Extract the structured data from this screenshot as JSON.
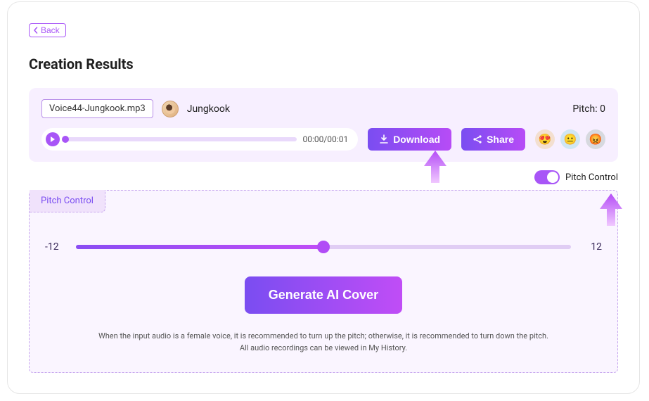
{
  "nav": {
    "back_label": "Back"
  },
  "page": {
    "title": "Creation Results"
  },
  "result": {
    "filename": "Voice44-Jungkook.mp3",
    "voice_name": "Jungkook",
    "pitch_label": "Pitch: 0",
    "time": "00:00/00:01",
    "download_label": "Download",
    "share_label": "Share",
    "reactions": [
      "😍",
      "😐",
      "😡"
    ]
  },
  "toggle": {
    "label": "Pitch Control",
    "on": true
  },
  "pitch_panel": {
    "tab_label": "Pitch Control",
    "min_label": "-12",
    "max_label": "12",
    "generate_label": "Generate AI Cover",
    "hint_line1": "When the input audio is a female voice, it is recommended to turn up the pitch; otherwise, it is recommended to turn down the pitch.",
    "hint_line2": "All audio recordings can be viewed in My History."
  }
}
